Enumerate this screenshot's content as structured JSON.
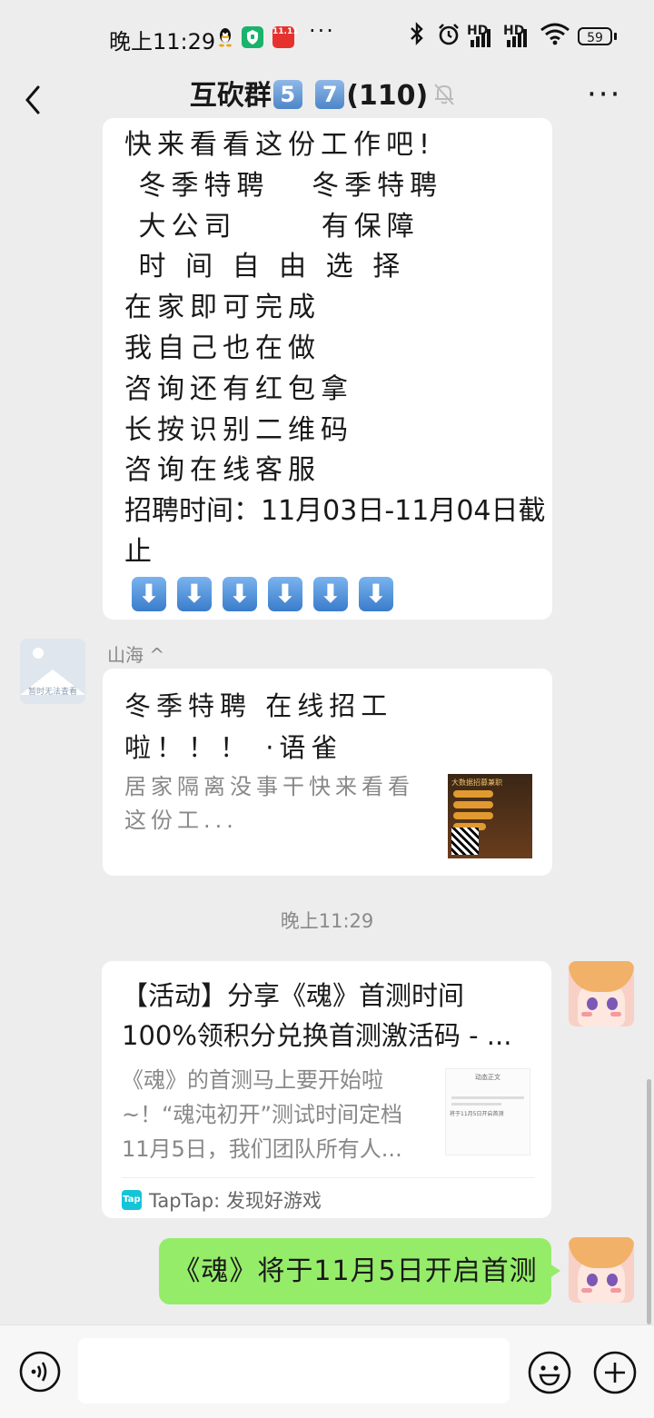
{
  "status_bar": {
    "time": "晚上11:29",
    "signal1_label": "HD",
    "signal2_label": "HD",
    "battery": "59",
    "overflow_dots": "···",
    "icons": [
      "qq-penguin-icon",
      "shield-app-icon",
      "taobao-1111-icon",
      "bluetooth-icon",
      "alarm-icon",
      "wifi-icon"
    ]
  },
  "header": {
    "title_prefix": "互砍群",
    "badge1": "5",
    "badge2": "7",
    "member_count": "(110)",
    "more_label": "···"
  },
  "message1": {
    "lines": [
      "快来看看这份工作吧!",
      " 冬季特聘   冬季特聘",
      " 大公司      有保障",
      " 时 间 自 由 选 择",
      "在家即可完成",
      "我自己也在做",
      "咨询还有红包拿",
      "长按识别二维码",
      "咨询在线客服",
      "招聘时间：11月03日-11月04日截",
      "止"
    ],
    "arrows": [
      "⬇",
      "⬇",
      "⬇",
      "⬇",
      "⬇",
      "⬇"
    ]
  },
  "message2": {
    "sender": "山海 ^",
    "avatar_text": "暂时无法查看",
    "title": "冬季特聘 在线招工啦！！！ ·语雀",
    "desc": "居家隔离没事干快来看看这份工...",
    "thumb_title": "大数据招募兼职"
  },
  "timestamp": "晚上11:29",
  "message3": {
    "title_line1": "【活动】分享《魂》首测时间",
    "title_line2": "100%领积分兑换首测激活码 - ...",
    "desc": "《魂》的首测马上要开始啦~！“魂沌初开”测试时间定档11月5日，我们团队所有人...",
    "thumb_header": "动态正文",
    "thumb_text": "将于11月5日开启首测",
    "source_icon": "Tap",
    "source": "TapTap: 发现好游戏"
  },
  "message4": {
    "text": "《魂》将于11月5日开启首测"
  },
  "input_bar": {
    "value": ""
  }
}
